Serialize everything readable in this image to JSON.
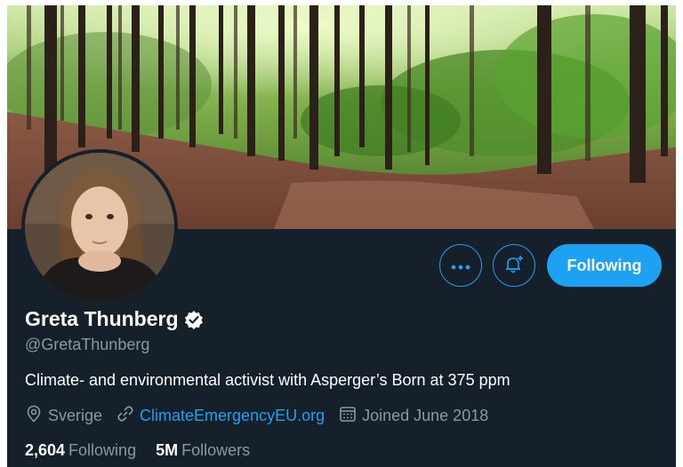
{
  "profile": {
    "display_name": "Greta Thunberg",
    "handle": "@GretaThunberg",
    "verified": true,
    "bio": "Climate- and environmental activist with Asperger’s  Born at 375 ppm",
    "location": "Sverige",
    "website": "ClimateEmergencyEU.org",
    "joined": "Joined June 2018"
  },
  "actions": {
    "follow_label": "Following"
  },
  "stats": {
    "following_count": "2,604",
    "following_label": "Following",
    "followers_count": "5M",
    "followers_label": "Followers"
  },
  "colors": {
    "background": "#15202b",
    "accent": "#1da1f2",
    "secondary_text": "#8899a6",
    "primary_text": "#ffffff"
  },
  "icons": {
    "more": "more-dots-icon",
    "notify": "bell-plus-icon",
    "verified": "verified-badge-icon",
    "location": "location-pin-icon",
    "link": "link-icon",
    "calendar": "calendar-icon"
  }
}
